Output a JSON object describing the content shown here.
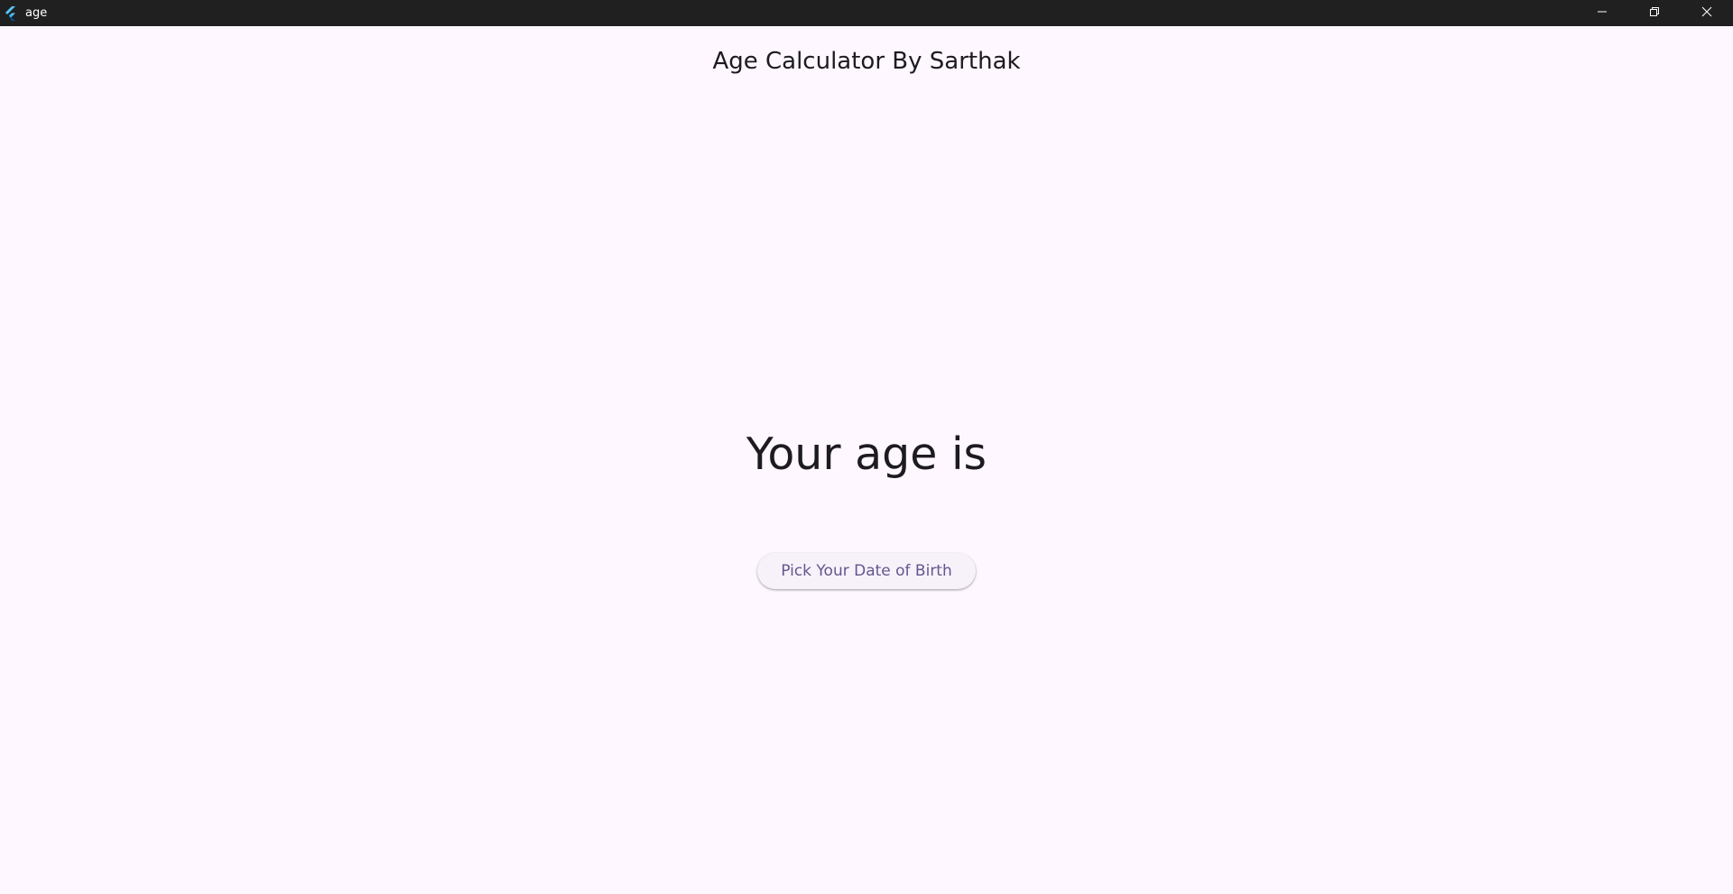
{
  "window": {
    "title": "age",
    "app_icon": "flutter-logo-icon",
    "controls": [
      "minimize-icon",
      "restore-icon",
      "close-icon"
    ],
    "titlebar_color": "#202020"
  },
  "header": {
    "title": "Age Calculator By Sarthak"
  },
  "main": {
    "age_label": "Your age is",
    "pick_button_label": "Pick Your Date of Birth"
  },
  "colors": {
    "background": "#fef7ff",
    "text": "#1d1b20",
    "button_text": "#65558f",
    "button_bg": "#f7f2fa"
  }
}
